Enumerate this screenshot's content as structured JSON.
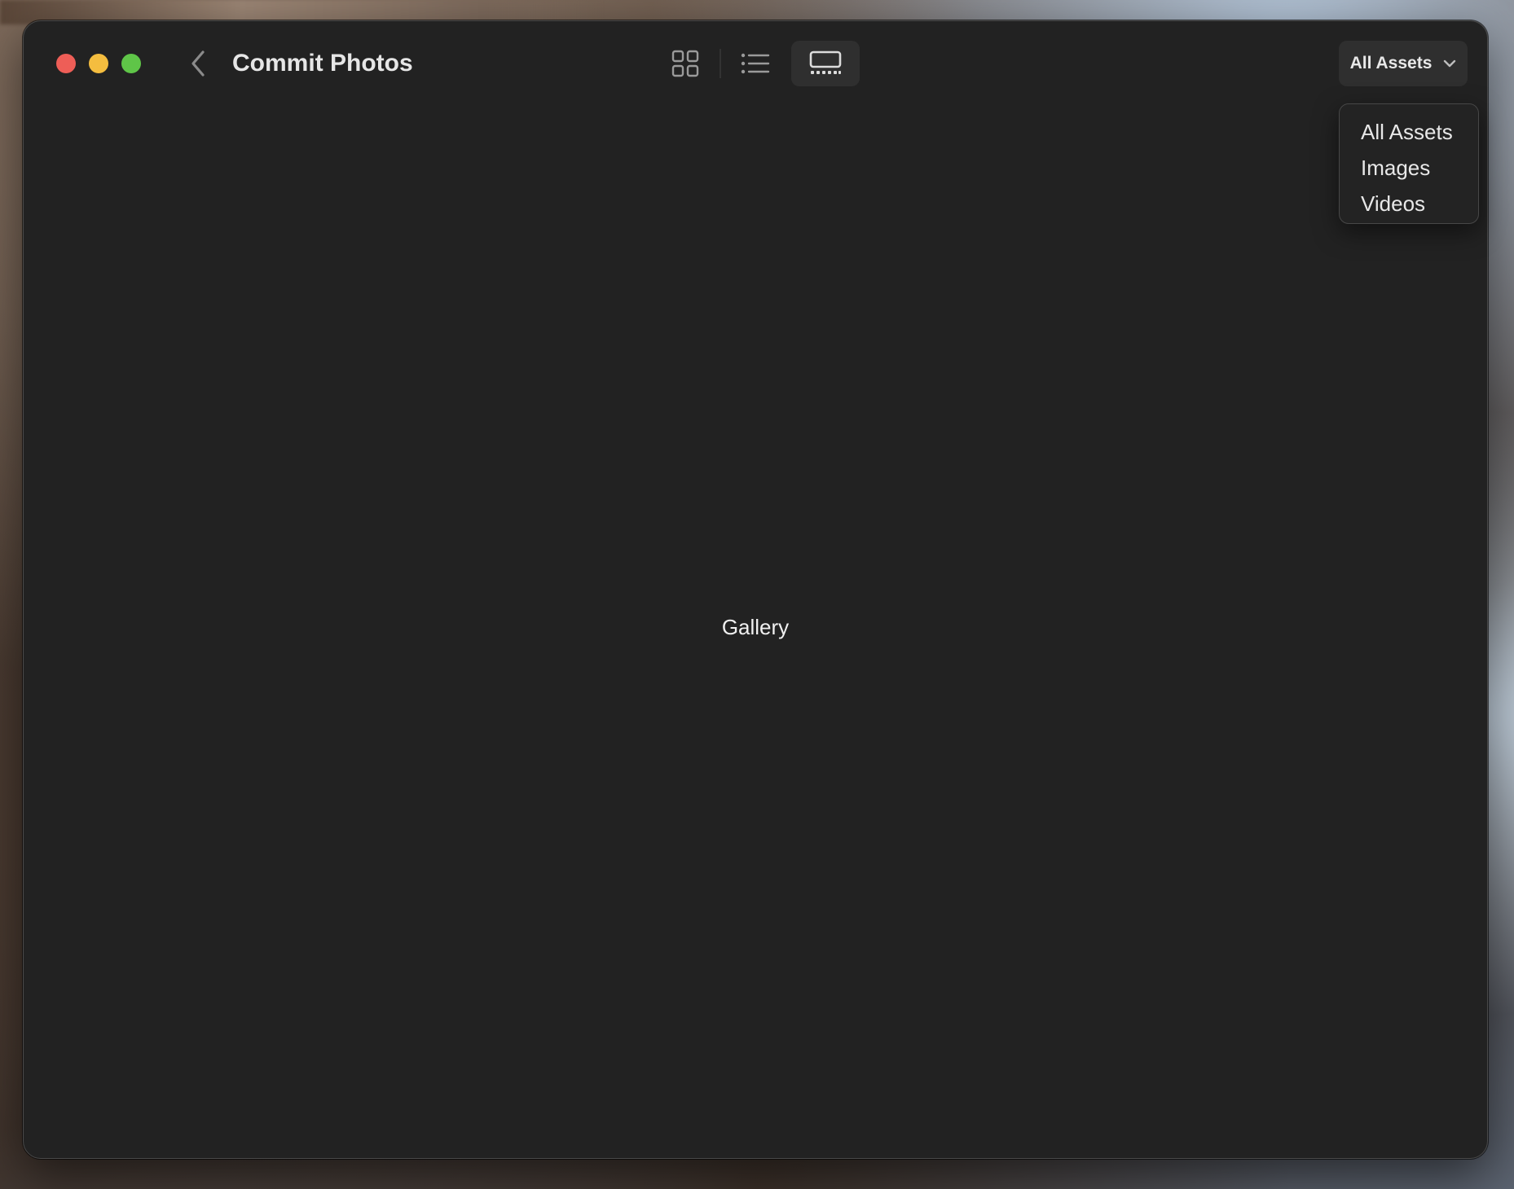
{
  "window": {
    "title": "Commit Photos"
  },
  "toolbar": {
    "back_icon": "chevron-left-icon",
    "views": [
      {
        "name": "grid",
        "icon": "grid-icon",
        "selected": false
      },
      {
        "name": "list",
        "icon": "list-icon",
        "selected": false
      },
      {
        "name": "gallery",
        "icon": "gallery-icon",
        "selected": true
      }
    ],
    "filter": {
      "label": "All Assets",
      "icon": "chevron-down-icon"
    }
  },
  "dropdown": {
    "items": [
      "All Assets",
      "Images",
      "Videos"
    ]
  },
  "main": {
    "placeholder": "Gallery"
  },
  "colors": {
    "window_bg": "#222222",
    "close": "#ee5e57",
    "minimize": "#f4bd3f",
    "zoom": "#5fc548",
    "selected_toggle_bg": "#2f2f2f",
    "text": "#e8e8e8"
  }
}
